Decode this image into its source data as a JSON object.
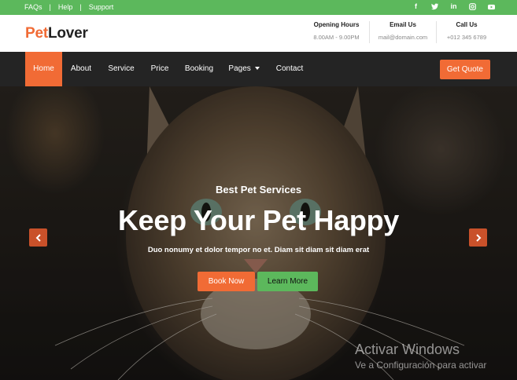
{
  "topbar": {
    "links": [
      "FAQs",
      "Help",
      "Support"
    ],
    "separator": "|",
    "social_icons": [
      "facebook-icon",
      "twitter-icon",
      "linkedin-icon",
      "instagram-icon",
      "youtube-icon"
    ],
    "bg_color": "#5cb85c"
  },
  "header": {
    "logo_pet": "Pet",
    "logo_lover": "Lover",
    "opening_title": "Opening Hours",
    "opening_value": "8.00AM - 9.00PM",
    "email_title": "Email Us",
    "email_value": "mail@domain.com",
    "call_title": "Call Us",
    "call_value": "+012 345 6789"
  },
  "nav": {
    "items": [
      "Home",
      "About",
      "Service",
      "Price",
      "Booking",
      "Pages",
      "Contact"
    ],
    "active": "Home",
    "quote_label": "Get Quote",
    "accent_color": "#f16b35"
  },
  "hero": {
    "subtitle": "Best Pet Services",
    "title": "Keep Your Pet Happy",
    "description": "Duo nonumy et dolor tempor no et. Diam sit diam sit diam erat",
    "book_label": "Book Now",
    "learn_label": "Learn More"
  },
  "watermark": {
    "line1": "Activar Windows",
    "line2": "Ve a Configuración para activar"
  }
}
